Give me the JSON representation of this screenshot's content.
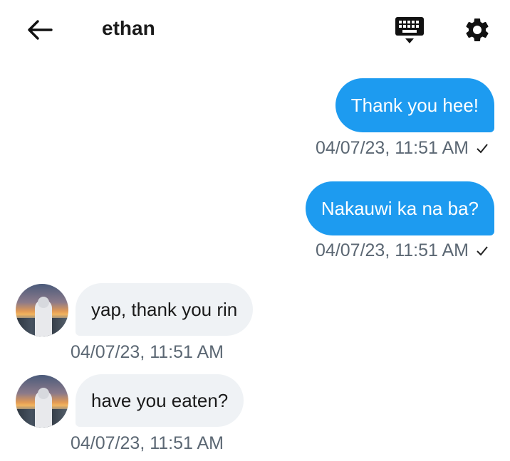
{
  "header": {
    "contact_name": "ethan",
    "icons": {
      "back": "arrow-left-icon",
      "keyboard": "keyboard-icon",
      "settings": "gear-icon"
    }
  },
  "colors": {
    "outgoing_bubble": "#1d9bf0",
    "incoming_bubble": "#eff2f5",
    "timestamp": "#5b6773"
  },
  "messages": [
    {
      "direction": "outgoing",
      "text": "Thank you hee!",
      "timestamp": "04/07/23, 11:51 AM",
      "status_icon": "check-icon"
    },
    {
      "direction": "outgoing",
      "text": "Nakauwi ka na ba?",
      "timestamp": "04/07/23, 11:51 AM",
      "status_icon": "check-icon"
    },
    {
      "direction": "incoming",
      "text": "yap, thank you rin",
      "timestamp": "04/07/23, 11:51 AM"
    },
    {
      "direction": "incoming",
      "text": "have you eaten?",
      "timestamp": "04/07/23, 11:51 AM"
    }
  ]
}
